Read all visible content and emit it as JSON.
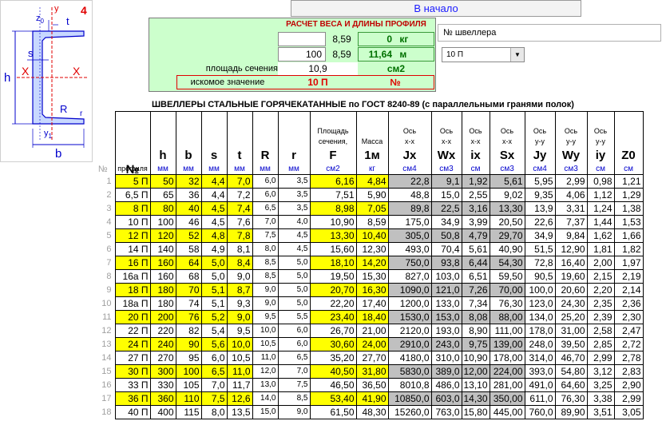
{
  "diagram": {
    "number": "4",
    "labels": {
      "h": "h",
      "b": "b",
      "s": "s",
      "t": "t",
      "R": "R",
      "r": "r",
      "x_left": "X",
      "x_right": "X",
      "y_top": "y",
      "z0": "z",
      "y1": "y",
      "z0_sub": "0",
      "y1_sub": "1"
    }
  },
  "top_button": {
    "label": "В начало"
  },
  "calc": {
    "title": "РАСЧЕТ ВЕСА И ДЛИНЫ ПРОФИЛЯ",
    "row1": {
      "input": "",
      "mid": "8,59",
      "out": "0",
      "unit": "кг"
    },
    "row2": {
      "input": "100",
      "mid": "8,59",
      "out": "11,64",
      "unit": "м"
    },
    "area": {
      "label": "площадь сечения",
      "value": "10,9",
      "unit": "см2"
    },
    "sought": {
      "label": "искомое значение",
      "value": "10 П",
      "unit": "№"
    }
  },
  "search": {
    "label": "№ швеллера"
  },
  "select": {
    "value": "10 П"
  },
  "table": {
    "title": "ШВЕЛЛЕРЫ СТАЛЬНЫЕ ГОРЯЧЕКАТАННЫЕ по ГОСТ 8240-89 (с параллельными гранями полок)",
    "row_num_header": "№",
    "headers": [
      {
        "top": "№",
        "mid": "профиля",
        "sym": "",
        "unit": ""
      },
      {
        "top": "",
        "mid": "",
        "sym": "h",
        "unit": "мм"
      },
      {
        "top": "",
        "mid": "",
        "sym": "b",
        "unit": "мм"
      },
      {
        "top": "",
        "mid": "",
        "sym": "s",
        "unit": "мм"
      },
      {
        "top": "",
        "mid": "",
        "sym": "t",
        "unit": "мм"
      },
      {
        "top": "",
        "mid": "",
        "sym": "R",
        "unit": "мм"
      },
      {
        "top": "",
        "mid": "",
        "sym": "r",
        "unit": "мм"
      },
      {
        "top": "Площадь",
        "mid": "сечения,",
        "sym": "F",
        "unit": "см2"
      },
      {
        "top": "",
        "mid": "Масса",
        "sym": "1м",
        "unit": "кг"
      },
      {
        "top": "Ось",
        "mid": "x-x",
        "sym": "Jx",
        "unit": "см4"
      },
      {
        "top": "Ось",
        "mid": "x-x",
        "sym": "Wx",
        "unit": "см3"
      },
      {
        "top": "Ось",
        "mid": "x-x",
        "sym": "ix",
        "unit": "см"
      },
      {
        "top": "Ось",
        "mid": "x-x",
        "sym": "Sx",
        "unit": "см3"
      },
      {
        "top": "Ось",
        "mid": "y-y",
        "sym": "Jy",
        "unit": "см4"
      },
      {
        "top": "Ось",
        "mid": "y-y",
        "sym": "Wy",
        "unit": "см3"
      },
      {
        "top": "Ось",
        "mid": "y-y",
        "sym": "iy",
        "unit": "см"
      },
      {
        "top": "",
        "mid": "",
        "sym": "Z0",
        "unit": "см"
      }
    ],
    "rows": [
      [
        "1",
        "5 П",
        "50",
        "32",
        "4,4",
        "7,0",
        "6,0",
        "3,5",
        "6,16",
        "4,84",
        "22,8",
        "9,1",
        "1,92",
        "5,61",
        "5,95",
        "2,99",
        "0,98",
        "1,21"
      ],
      [
        "2",
        "6,5 П",
        "65",
        "36",
        "4,4",
        "7,2",
        "6,0",
        "3,5",
        "7,51",
        "5,90",
        "48,8",
        "15,0",
        "2,55",
        "9,02",
        "9,35",
        "4,06",
        "1,12",
        "1,29"
      ],
      [
        "3",
        "8 П",
        "80",
        "40",
        "4,5",
        "7,4",
        "6,5",
        "3,5",
        "8,98",
        "7,05",
        "89,8",
        "22,5",
        "3,16",
        "13,30",
        "13,9",
        "3,31",
        "1,24",
        "1,38"
      ],
      [
        "4",
        "10 П",
        "100",
        "46",
        "4,5",
        "7,6",
        "7,0",
        "4,0",
        "10,90",
        "8,59",
        "175,0",
        "34,9",
        "3,99",
        "20,50",
        "22,6",
        "7,37",
        "1,44",
        "1,53"
      ],
      [
        "5",
        "12 П",
        "120",
        "52",
        "4,8",
        "7,8",
        "7,5",
        "4,5",
        "13,30",
        "10,40",
        "305,0",
        "50,8",
        "4,79",
        "29,70",
        "34,9",
        "9,84",
        "1,62",
        "1,66"
      ],
      [
        "6",
        "14 П",
        "140",
        "58",
        "4,9",
        "8,1",
        "8,0",
        "4,5",
        "15,60",
        "12,30",
        "493,0",
        "70,4",
        "5,61",
        "40,90",
        "51,5",
        "12,90",
        "1,81",
        "1,82"
      ],
      [
        "7",
        "16 П",
        "160",
        "64",
        "5,0",
        "8,4",
        "8,5",
        "5,0",
        "18,10",
        "14,20",
        "750,0",
        "93,8",
        "6,44",
        "54,30",
        "72,8",
        "16,40",
        "2,00",
        "1,97"
      ],
      [
        "8",
        "16а П",
        "160",
        "68",
        "5,0",
        "9,0",
        "8,5",
        "5,0",
        "19,50",
        "15,30",
        "827,0",
        "103,0",
        "6,51",
        "59,50",
        "90,5",
        "19,60",
        "2,15",
        "2,19"
      ],
      [
        "9",
        "18 П",
        "180",
        "70",
        "5,1",
        "8,7",
        "9,0",
        "5,0",
        "20,70",
        "16,30",
        "1090,0",
        "121,0",
        "7,26",
        "70,00",
        "100,0",
        "20,60",
        "2,20",
        "2,14"
      ],
      [
        "10",
        "18а П",
        "180",
        "74",
        "5,1",
        "9,3",
        "9,0",
        "5,0",
        "22,20",
        "17,40",
        "1200,0",
        "133,0",
        "7,34",
        "76,30",
        "123,0",
        "24,30",
        "2,35",
        "2,36"
      ],
      [
        "11",
        "20 П",
        "200",
        "76",
        "5,2",
        "9,0",
        "9,5",
        "5,5",
        "23,40",
        "18,40",
        "1530,0",
        "153,0",
        "8,08",
        "88,00",
        "134,0",
        "25,20",
        "2,39",
        "2,30"
      ],
      [
        "12",
        "22 П",
        "220",
        "82",
        "5,4",
        "9,5",
        "10,0",
        "6,0",
        "26,70",
        "21,00",
        "2120,0",
        "193,0",
        "8,90",
        "111,00",
        "178,0",
        "31,00",
        "2,58",
        "2,47"
      ],
      [
        "13",
        "24 П",
        "240",
        "90",
        "5,6",
        "10,0",
        "10,5",
        "6,0",
        "30,60",
        "24,00",
        "2910,0",
        "243,0",
        "9,75",
        "139,00",
        "248,0",
        "39,50",
        "2,85",
        "2,72"
      ],
      [
        "14",
        "27 П",
        "270",
        "95",
        "6,0",
        "10,5",
        "11,0",
        "6,5",
        "35,20",
        "27,70",
        "4180,0",
        "310,0",
        "10,90",
        "178,00",
        "314,0",
        "46,70",
        "2,99",
        "2,78"
      ],
      [
        "15",
        "30 П",
        "300",
        "100",
        "6,5",
        "11,0",
        "12,0",
        "7,0",
        "40,50",
        "31,80",
        "5830,0",
        "389,0",
        "12,00",
        "224,00",
        "393,0",
        "54,80",
        "3,12",
        "2,83"
      ],
      [
        "16",
        "33 П",
        "330",
        "105",
        "7,0",
        "11,7",
        "13,0",
        "7,5",
        "46,50",
        "36,50",
        "8010,8",
        "486,0",
        "13,10",
        "281,00",
        "491,0",
        "64,60",
        "3,25",
        "2,90"
      ],
      [
        "17",
        "36 П",
        "360",
        "110",
        "7,5",
        "12,6",
        "14,0",
        "8,5",
        "53,40",
        "41,90",
        "10850,0",
        "603,0",
        "14,30",
        "350,00",
        "611,0",
        "76,30",
        "3,38",
        "2,99"
      ],
      [
        "18",
        "40 П",
        "400",
        "115",
        "8,0",
        "13,5",
        "15,0",
        "9,0",
        "61,50",
        "48,30",
        "15260,0",
        "763,0",
        "15,80",
        "445,00",
        "760,0",
        "89,90",
        "3,51",
        "3,05"
      ]
    ]
  }
}
